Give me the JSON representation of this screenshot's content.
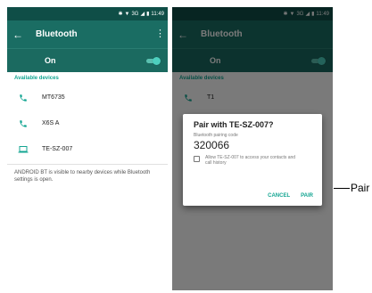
{
  "status_bar": {
    "time": "11:49",
    "network": "3G",
    "signal_icon": "signal-icon",
    "wifi_icon": "wifi-icon",
    "bluetooth_icon": "bluetooth-icon",
    "battery_icon": "battery-icon"
  },
  "toolbar": {
    "title": "Bluetooth",
    "back_icon": "arrow-back-icon",
    "menu_icon": "more-vert-icon"
  },
  "bluetooth_toggle": {
    "label": "On",
    "state": "on"
  },
  "available_devices": {
    "header": "Available devices",
    "items": [
      {
        "name": "MT6735",
        "icon": "phone-icon"
      },
      {
        "name": "X6S A",
        "icon": "phone-icon"
      },
      {
        "name": "TE-SZ-007",
        "icon": "laptop-icon"
      }
    ]
  },
  "footer": {
    "visibility_text": "ANDROID BT is visible to nearby devices while Bluetooth settings is open."
  },
  "right_screen": {
    "first_device": "T1"
  },
  "pair_dialog": {
    "title": "Pair with TE-SZ-007?",
    "subtitle": "Bluetooth pairing code",
    "code": "320066",
    "checkbox_label": "Allow TE-SZ-007 to access your contacts and call history",
    "checkbox_checked": false,
    "cancel_label": "CANCEL",
    "pair_label": "PAIR"
  },
  "callout": {
    "label": "Pair"
  },
  "colors": {
    "accent": "#13a592",
    "toolbar": "#1a6d63",
    "status_bar": "#0f4e47"
  }
}
